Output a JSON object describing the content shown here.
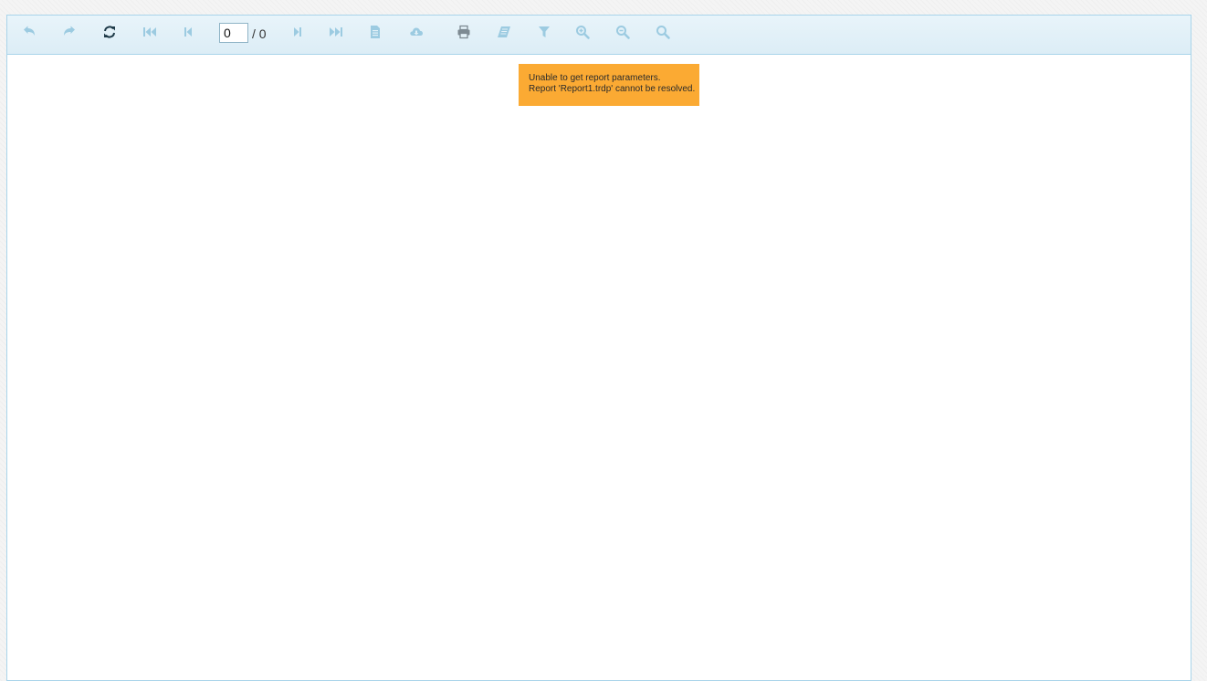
{
  "toolbar": {
    "buttons": {
      "back": "arrow-back-icon",
      "forward": "arrow-forward-icon",
      "refresh": "refresh-icon",
      "first_page": "first-page-icon",
      "previous_page": "previous-page-icon",
      "next_page": "next-page-icon",
      "last_page": "last-page-icon",
      "toggle_view": "document-icon",
      "export": "cloud-download-icon",
      "print": "print-icon",
      "toggle_document_map": "book-icon",
      "toggle_parameters": "filter-icon",
      "zoom_in": "zoom-in-icon",
      "zoom_out": "zoom-out-icon",
      "scale_mode": "search-icon"
    },
    "page_input_value": "0",
    "page_total": "/ 0",
    "colors": {
      "disabled_icon": "#9ccbe1",
      "enabled_icon": "#1e3a48",
      "print_icon": "#7d8a92",
      "toolbar_background": "#e3f1f8",
      "border": "#a9d4ea"
    }
  },
  "error": {
    "line1": "Unable to get report parameters.",
    "line2": "Report 'Report1.trdp' cannot be resolved.",
    "background": "#fbaa33"
  }
}
